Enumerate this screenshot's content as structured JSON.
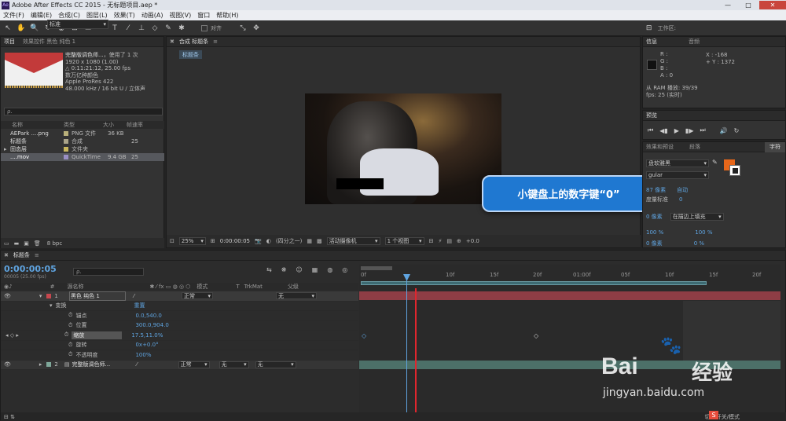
{
  "app": {
    "title": "Adobe After Effects CC 2015 - 无标题项目.aep *",
    "logo": "Ae",
    "win_min": "—",
    "win_max": "□",
    "win_close": "✕"
  },
  "menu": [
    "文件(F)",
    "编辑(E)",
    "合成(C)",
    "图层(L)",
    "效果(T)",
    "动画(A)",
    "视图(V)",
    "窗口",
    "帮助(H)"
  ],
  "toolbar": {
    "snap_label": "对齐",
    "workspace_label": "工作区:",
    "workspace_value": "标准"
  },
  "project": {
    "tab": "项目",
    "tab_effects": "效果控件 黑色 纯色 1",
    "preview_name": "完整版调色师...",
    "preview_used": "，使用了 1 次",
    "info": [
      "1920 x 1080 (1.00)",
      "△ 0:11:21:12, 25.00 fps",
      "数万亿种颜色",
      "Apple ProRes 422",
      "48.000 kHz / 16 bit U / 立体声"
    ],
    "search_placeholder": "ρ.",
    "headers": [
      "名称",
      "类型",
      "大小",
      "帧速率"
    ],
    "items": [
      {
        "name": "AEPark ....png",
        "type": "PNG 文件",
        "size": "36 KB",
        "fps": "",
        "color": "#b9b07a"
      },
      {
        "name": "标题条",
        "type": "合成",
        "size": "",
        "fps": "25",
        "color": "#aaa48a"
      },
      {
        "name": "固态层",
        "type": "文件夹",
        "size": "",
        "fps": "",
        "color": "#c9b75d"
      },
      {
        "name": "....mov",
        "type": "QuickTime",
        "size": "9.4 GB",
        "fps": "25",
        "color": "#9a8fc4"
      }
    ],
    "bpc": "8 bpc"
  },
  "comp": {
    "tab": "合成 标题条",
    "sub": "标题条",
    "zoom": "25%",
    "time": "0:00:00:05",
    "res": "(四分之一)",
    "camera": "活动摄像机",
    "views": "1 个视图",
    "offset": "+0.0",
    "caption": "小键盘上的数字键“0”"
  },
  "info_panel": {
    "tab": "信息",
    "tab2": "音频",
    "r": "R :",
    "g": "G :",
    "b": "B :",
    "a": "A : 0",
    "x": "X : -168",
    "y": "+ Y : 1372",
    "ram": "从 RAM 播放: 39/39",
    "fps": "fps: 25 (实时)"
  },
  "preview_panel": {
    "tab": "预览"
  },
  "char_panel": {
    "tab1": "效果和预设",
    "tab2": "段落",
    "tab3": "字符",
    "font": "盘软雅黑",
    "style": "gular",
    "size": "87 像素",
    "auto": "自动",
    "tracking": "度量标准",
    "tracking2": "0",
    "stroke": "0 像素",
    "stroke_mode": "在描边上填充",
    "vscale": "100 %",
    "hscale": "100 %",
    "baseline": "0 像素",
    "tsume": "0 %"
  },
  "timeline": {
    "tab": "标题条",
    "time": "0:00:00:05",
    "frames": "00005 (25.00 fps)",
    "search_placeholder": "ρ.",
    "col_num": "#",
    "col_name": "源名称",
    "col_mode": "模式",
    "col_t": "T",
    "col_trkmat": "TrkMat",
    "col_parent": "父级",
    "ruler": [
      "0f",
      "10f",
      "15f",
      "20f",
      "01:00f",
      "05f",
      "10f",
      "15f",
      "20f"
    ],
    "layers": [
      {
        "num": "1",
        "name": "黑色 纯色 1",
        "mode": "正常",
        "trkmat": "",
        "parent": "无",
        "color": "#c8474e"
      },
      {
        "num": "2",
        "name": "完整版调色师...",
        "mode": "正常",
        "trkmat": "无",
        "parent": "无",
        "color": "#7fa89a"
      }
    ],
    "transform": {
      "label": "变换",
      "reset": "重置",
      "props": [
        {
          "name": "锚点",
          "value": "0.0,540.0"
        },
        {
          "name": "位置",
          "value": "300.0,904.0"
        },
        {
          "name": "缩放",
          "value": "17.5,11.0%"
        },
        {
          "name": "旋转",
          "value": "0x+0.0°"
        },
        {
          "name": "不透明度",
          "value": "100%"
        }
      ]
    },
    "footer": "切换开关/模式"
  },
  "watermark": {
    "brand": "Bai",
    "brand2": "经验",
    "url": "jingyan.baidu.com"
  },
  "status_badge": "S",
  "colors": {
    "accent": "#5fa4e0",
    "playhead": "#e0262e",
    "caption_bg": "#1f78d1",
    "layer1_bar": "#8e3d45",
    "layer2_bar": "#4c7068",
    "char_tab": "#e8671a"
  }
}
